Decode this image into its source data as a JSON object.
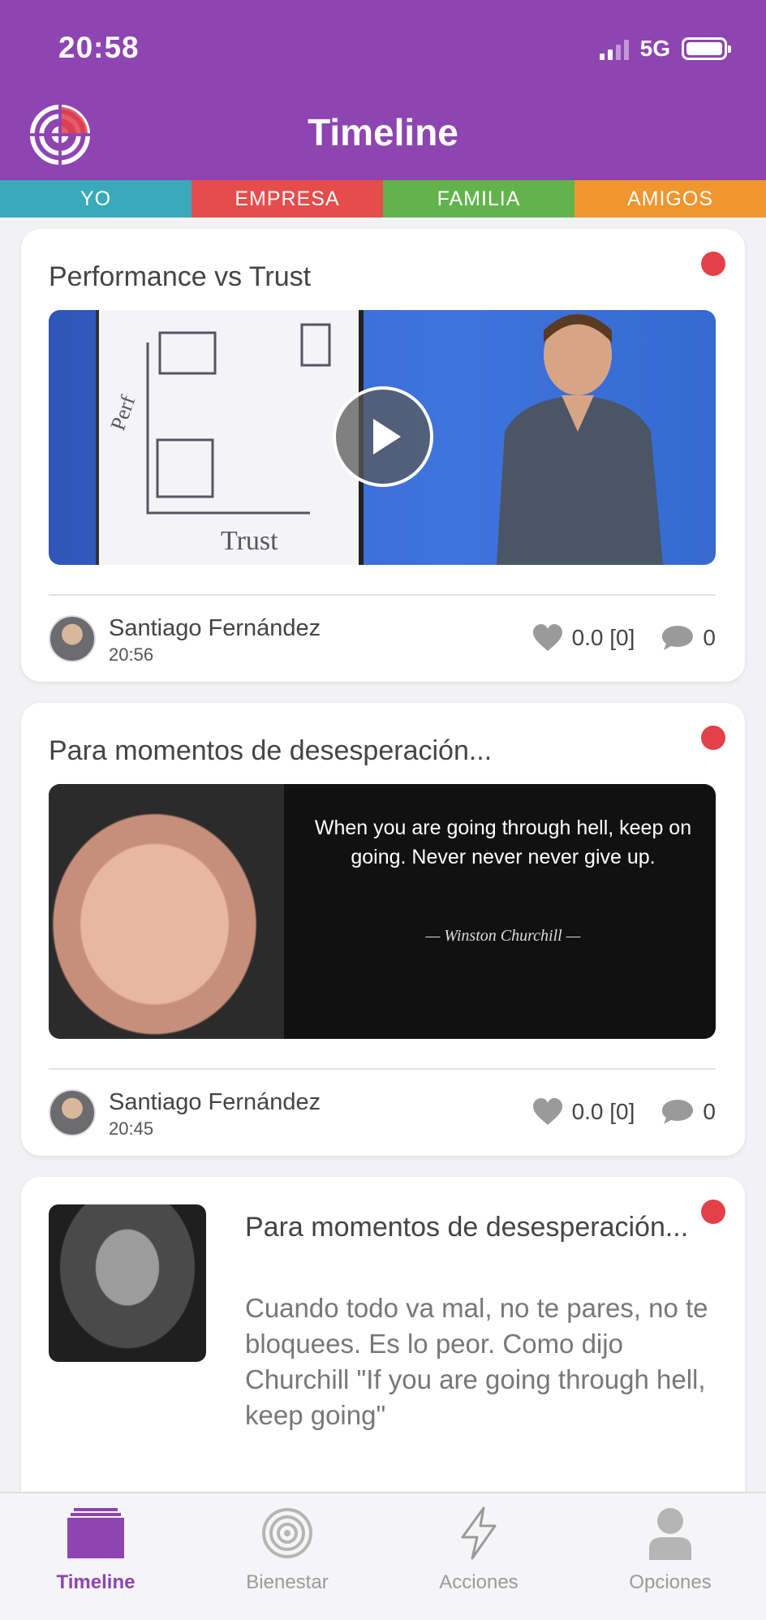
{
  "colors": {
    "header": "#8e44b1",
    "dot": "#e5404a",
    "tab_yo": "#3aa9b9",
    "tab_empresa": "#e74c4c",
    "tab_familia": "#63b34d",
    "tab_amigos": "#f0962e",
    "active": "#8e44b1"
  },
  "status_bar": {
    "time": "20:58",
    "network": "5G",
    "icons": [
      "signal-icon",
      "battery-icon"
    ]
  },
  "header": {
    "title": "Timeline",
    "logo_icon": "target-logo-icon"
  },
  "category_tabs": [
    {
      "label": "YO"
    },
    {
      "label": "EMPRESA"
    },
    {
      "label": "FAMILIA"
    },
    {
      "label": "AMIGOS"
    }
  ],
  "posts": [
    {
      "title": "Performance vs Trust",
      "media_type": "video",
      "author": "Santiago Fernández",
      "time": "20:56",
      "rating": "0.0 [0]",
      "comments": "0"
    },
    {
      "title": "Para momentos de desesperación...",
      "media_type": "image",
      "quote": "When you are going through hell, keep on going. Never never never give up.",
      "quote_author": "— Winston Churchill —",
      "author": "Santiago Fernández",
      "time": "20:45",
      "rating": "0.0 [0]",
      "comments": "0"
    },
    {
      "title": "Para momentos de desesperación...",
      "body": "Cuando todo va mal, no te pares, no te bloquees. Es lo peor. Como dijo Churchill \"If you are going through hell, keep going\""
    }
  ],
  "bottom_nav": [
    {
      "label": "Timeline",
      "icon": "layers-icon",
      "active": true
    },
    {
      "label": "Bienestar",
      "icon": "spiral-icon",
      "active": false
    },
    {
      "label": "Acciones",
      "icon": "lightning-icon",
      "active": false
    },
    {
      "label": "Opciones",
      "icon": "user-icon",
      "active": false
    }
  ]
}
